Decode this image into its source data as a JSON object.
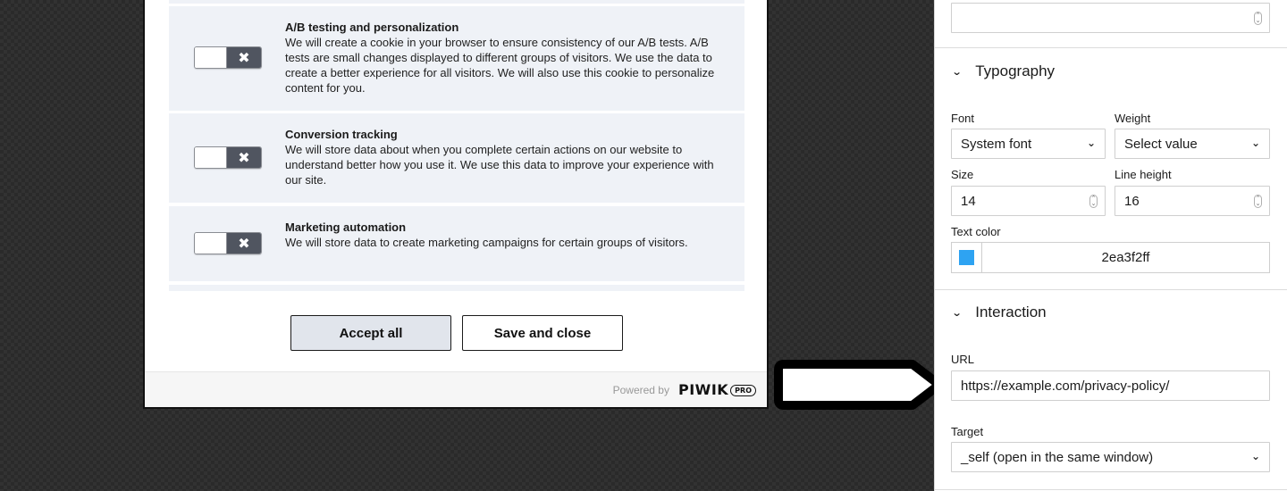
{
  "modal": {
    "categories": [
      {
        "title": "A/B testing and personalization",
        "description": "We will create a cookie in your browser to ensure consistency of our A/B tests. A/B tests are small changes displayed to different groups of visitors. We use the data to create a better experience for all visitors. We will also use this cookie to personalize content for you.",
        "enabled": false,
        "toggle_icon": "x-icon"
      },
      {
        "title": "Conversion tracking",
        "description": "We will store data about when you complete certain actions on our website to understand better how you use it. We use this data to improve your experience with our site.",
        "enabled": false,
        "toggle_icon": "x-icon"
      },
      {
        "title": "Marketing automation",
        "description": "We will store data to create marketing campaigns for certain groups of visitors.",
        "enabled": false,
        "toggle_icon": "x-icon"
      }
    ],
    "toggle_off_glyph": "✖",
    "buttons": {
      "accept_all": "Accept all",
      "save_and_close": "Save and close"
    },
    "footer": {
      "powered_by": "Powered by",
      "brand": "PIWIK",
      "brand_badge": "PRO"
    }
  },
  "panel": {
    "top_field_value": "",
    "typography": {
      "title": "Typography",
      "font_label": "Font",
      "font_value": "System font",
      "weight_label": "Weight",
      "weight_value": "Select value",
      "size_label": "Size",
      "size_value": "14",
      "line_height_label": "Line height",
      "line_height_value": "16",
      "text_color_label": "Text color",
      "text_color_value": "2ea3f2ff",
      "text_color_hex": "#2ea3f2"
    },
    "interaction": {
      "title": "Interaction",
      "url_label": "URL",
      "url_value": "https://example.com/privacy-policy/",
      "target_label": "Target",
      "target_value": "_self (open in the same window)"
    },
    "icons": {
      "chevron": "⌄",
      "caret": "⌄",
      "spin_up": "⌃",
      "spin_down": "⌄"
    }
  },
  "annotation": {
    "arrow_icon": "arrow-right-icon",
    "arrow_color": "#000000",
    "arrow_fill": "#ffffff"
  }
}
